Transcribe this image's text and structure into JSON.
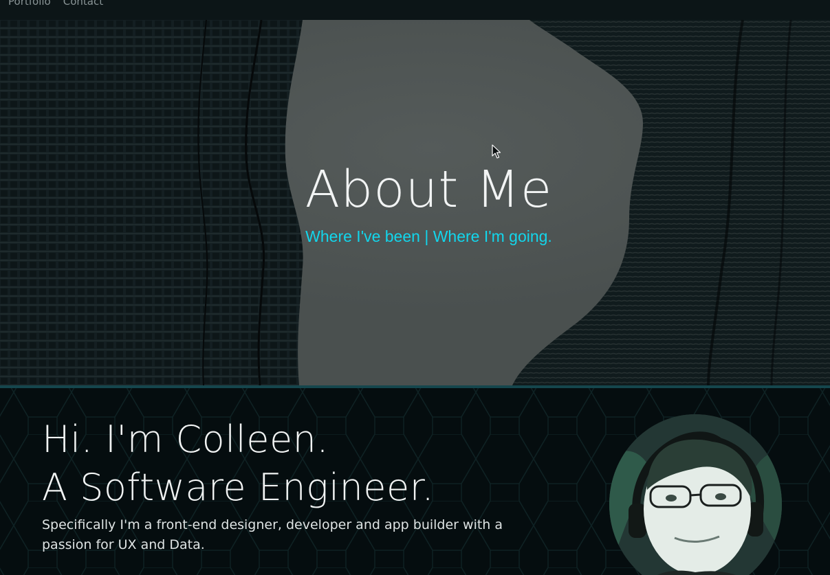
{
  "nav": {
    "links": [
      "Portfolio",
      "Contact"
    ]
  },
  "hero": {
    "title": "About Me",
    "subtitle": "Where I've been | Where I'm going."
  },
  "intro": {
    "heading_line1": "Hi. I'm Colleen.",
    "heading_line2": "A Software Engineer.",
    "body": "Specifically I'm a front-end designer, developer and app builder with a passion for UX and Data."
  },
  "colors": {
    "accent": "#12d6ec",
    "background": "#040c0d",
    "divider": "#15464d"
  },
  "icons": {
    "cursor": "mouse-pointer-icon"
  }
}
